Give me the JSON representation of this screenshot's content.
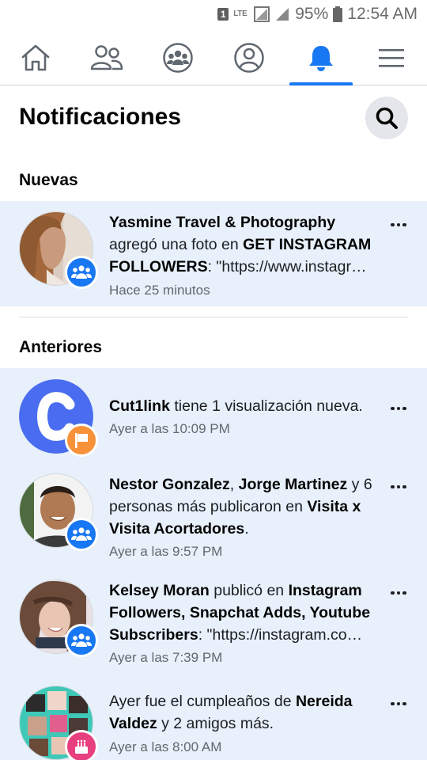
{
  "status_bar": {
    "sim_label": "1",
    "network_label": "LTE",
    "battery_percent": "95%",
    "time": "12:54 AM"
  },
  "nav": {
    "items": [
      {
        "icon": "home-icon",
        "active": false
      },
      {
        "icon": "friends-icon",
        "active": false
      },
      {
        "icon": "groups-icon",
        "active": false
      },
      {
        "icon": "profile-icon",
        "active": false
      },
      {
        "icon": "bell-icon",
        "active": true
      },
      {
        "icon": "menu-icon",
        "active": false
      }
    ],
    "accent_color": "#1877f2"
  },
  "header": {
    "title": "Notificaciones",
    "search_icon": "search-icon"
  },
  "sections": {
    "new_title": "Nuevas",
    "earlier_title": "Anteriores"
  },
  "notifications": [
    {
      "actor": "Yasmine Travel & Photography",
      "text1": " agregó una foto en ",
      "group": "GET INSTAGRAM FOLLOWERS",
      "text2": ": \"https://www.instagr…",
      "time": "Hace 25 minutos",
      "badge": "groups-icon"
    },
    {
      "actor": "Cut1link",
      "text1": " tiene 1 visualización nueva.",
      "time": "Ayer a las 10:09 PM",
      "badge": "flag-icon"
    },
    {
      "actor": "Nestor Gonzalez",
      "sep": ", ",
      "actor2": "Jorge Martinez",
      "text1": " y 6 personas más publicaron en ",
      "group": "Visita x Visita Acortadores",
      "text2": ".",
      "time": "Ayer a las 9:57 PM",
      "badge": "groups-icon"
    },
    {
      "actor": "Kelsey Moran",
      "text1": " publicó en ",
      "group": "Instagram Followers, Snapchat Adds, Youtube Subscribers",
      "text2": ": \"https://instagram.co…",
      "time": "Ayer a las 7:39 PM",
      "badge": "groups-icon"
    },
    {
      "text1": "Ayer fue el cumpleaños de ",
      "actor": "Nereida Valdez",
      "text2": " y 2 amigos más.",
      "time": "Ayer a las 8:00 AM",
      "badge": "cake-icon"
    }
  ],
  "colors": {
    "unread_bg": "#e7f0fb",
    "group_badge": "#1877f2",
    "page_badge": "#f7923a",
    "birthday_badge": "#e8407f"
  }
}
